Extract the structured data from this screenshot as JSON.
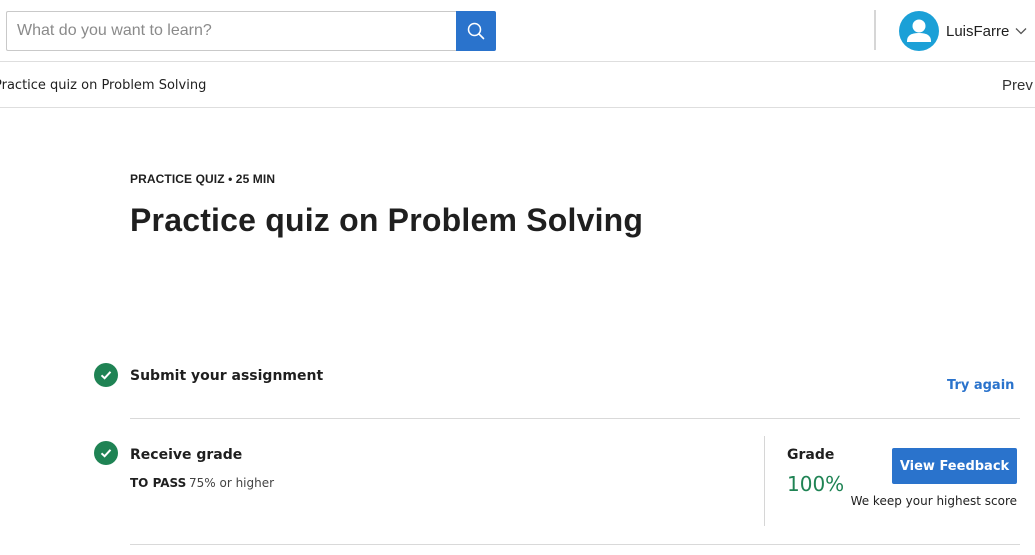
{
  "header": {
    "search": {
      "placeholder": "What do you want to learn?",
      "value": ""
    },
    "search_icon": "search-icon",
    "user": {
      "name": "LuisFarre",
      "avatar_icon": "person-icon",
      "menu_icon": "chevron-down-icon"
    }
  },
  "breadcrumb": {
    "current": "Practice quiz on Problem Solving",
    "prev_label": "Prev"
  },
  "main": {
    "eyebrow": "PRACTICE QUIZ • 25 MIN",
    "title": "Practice quiz on Problem Solving",
    "steps": [
      {
        "title": "Submit your assignment",
        "status_icon": "check-circle-icon",
        "action_label": "Try again"
      },
      {
        "title": "Receive grade",
        "status_icon": "check-circle-icon",
        "pass_label": "TO PASS",
        "pass_value": "75% or higher"
      }
    ],
    "grade": {
      "label": "Grade",
      "value": "100%",
      "feedback_label": "View Feedback",
      "note": "We keep your highest score"
    }
  },
  "colors": {
    "accent": "#2a73cc",
    "success": "#1f8354",
    "avatar": "#1ba0d7"
  }
}
